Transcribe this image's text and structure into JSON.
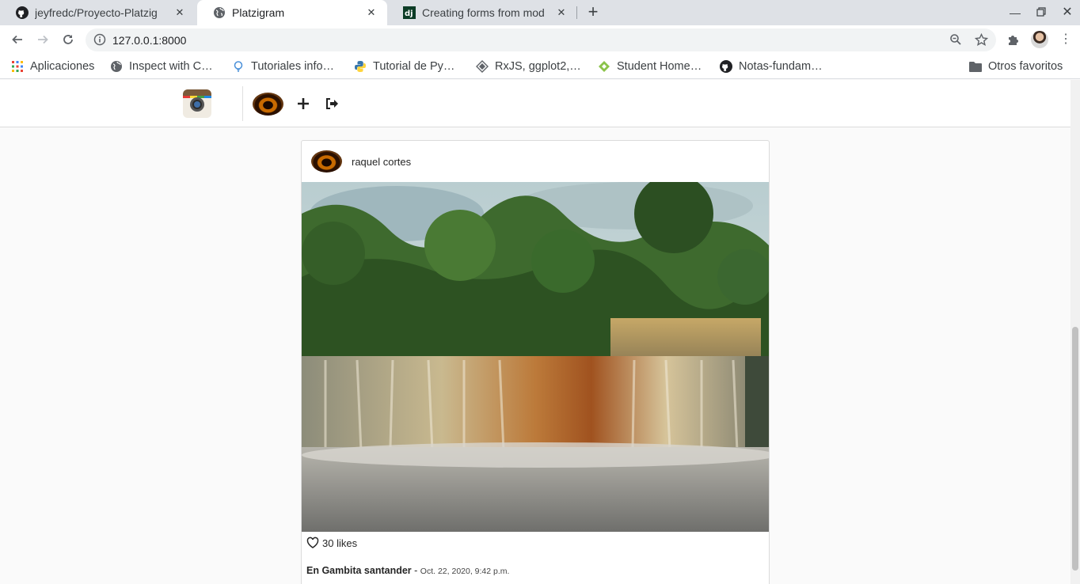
{
  "browser": {
    "tabs": [
      {
        "title": "jeyfredc/Proyecto-Platzig",
        "icon": "github-icon",
        "active": false
      },
      {
        "title": "Platzigram",
        "icon": "globe-icon",
        "active": true
      },
      {
        "title": "Creating forms from mod",
        "icon": "django-icon",
        "active": false
      }
    ],
    "url": "127.0.0.1:8000",
    "bookmarks": [
      {
        "label": "Aplicaciones",
        "icon": "apps-grid-icon"
      },
      {
        "label": "Inspect with C…",
        "icon": "globe-icon"
      },
      {
        "label": "Tutoriales info…",
        "icon": "bulb-icon"
      },
      {
        "label": "Tutorial de Py…",
        "icon": "python-icon"
      },
      {
        "label": "RxJS, ggplot2,…",
        "icon": "diamond-icon"
      },
      {
        "label": "Student Home…",
        "icon": "student-icon"
      },
      {
        "label": "Notas-fundam…",
        "icon": "github-icon"
      }
    ],
    "other_bookmarks": "Otros favoritos"
  },
  "post": {
    "author": "raquel cortes",
    "likes": "30 likes",
    "caption_title": "En Gambita santander",
    "caption_sep": " - ",
    "date": "Oct. 22, 2020, 9:42 p.m."
  },
  "colors": {
    "tab_strip": "#dee1e6",
    "page_bg": "#fafafa",
    "card_border": "#dbdbdb"
  }
}
